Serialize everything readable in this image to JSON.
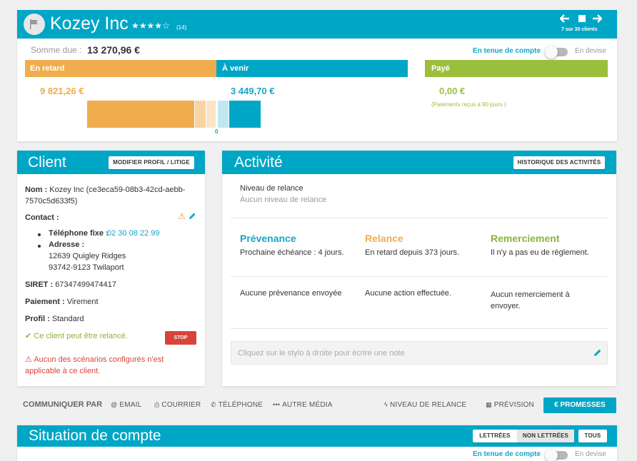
{
  "header": {
    "title": "Kozey Inc",
    "review_count": "(14)",
    "rating": 4,
    "pagination": "7 sur 30 clients"
  },
  "summary": {
    "due_label": "Somme due :",
    "due_value": "13 270,96 €",
    "toggle_left": "En tenue de compte",
    "toggle_right": "En devise",
    "late_label": "En retard",
    "late_value": "9 821,26 €",
    "upcoming_label": "À venir",
    "upcoming_value": "3 449,70 €",
    "paid_label": "Payé",
    "paid_value": "0,00 €",
    "paid_note": "(Paiements reçus à 90 jours )",
    "bar_zero": "0"
  },
  "client": {
    "title": "Client",
    "edit_button": "MODIFIER PROFIL / LITIGE",
    "name_label": "Nom :",
    "name_value": "Kozey Inc (ce3eca59-08b3-42cd-aebb-7570c5d633f5)",
    "contact_label": "Contact :",
    "phone_label": "Téléphone fixe :",
    "phone_value": "02 30 08 22 99",
    "address_label": "Adresse :",
    "address_line1": "12639 Quigley Ridges",
    "address_line2": "93742-9123 Twilaport",
    "siret_label": "SIRET :",
    "siret_value": "67347499474417",
    "payment_label": "Paiement :",
    "payment_value": "Virement",
    "profile_label": "Profil :",
    "profile_value": "Standard",
    "relance_ok": "Ce client peut être relancé.",
    "stop_button": "STOP",
    "warning": "Aucun des scénarios configurés n'est applicable à ce client."
  },
  "activity": {
    "title": "Activité",
    "history_button": "HISTORIQUE DES ACTIVITÉS",
    "level_label": "Niveau de relance",
    "level_value": "Aucun niveau de relance",
    "prevenance_title": "Prévenance",
    "prevenance_text": "Prochaine échéance : 4 jours.",
    "prevenance_status": "Aucune prévenance envoyée",
    "relance_title": "Relance",
    "relance_text": "En retard depuis 373 jours.",
    "relance_status": "Aucune action effectuée.",
    "remerciement_title": "Remerciement",
    "remerciement_text": "Il n'y a pas eu de règlement.",
    "remerciement_status": "Aucun remerciement à envoyer.",
    "note_placeholder": "Cliquez sur le stylo à droite pour écrire une note"
  },
  "communication": {
    "label": "COMMUNIQUER PAR",
    "email": "EMAIL",
    "courrier": "COURRIER",
    "telephone": "TÉLÉPHONE",
    "autre": "AUTRE MÉDIA",
    "niveau": "NIVEAU DE RELANCE",
    "prevision": "PRÉVISION",
    "promesses": "PROMESSES"
  },
  "situation": {
    "title": "Situation de compte",
    "tab_lettrees": "LETTRÉES",
    "tab_non_lettrees": "NON LETTRÉES",
    "tab_tous": "TOUS",
    "toggle_left": "En tenue de compte",
    "toggle_right": "En devise"
  },
  "colors": {
    "teal": "#00a6c6",
    "orange": "#f0ad4e",
    "green": "#9bbf3d",
    "red": "#d9443a"
  }
}
